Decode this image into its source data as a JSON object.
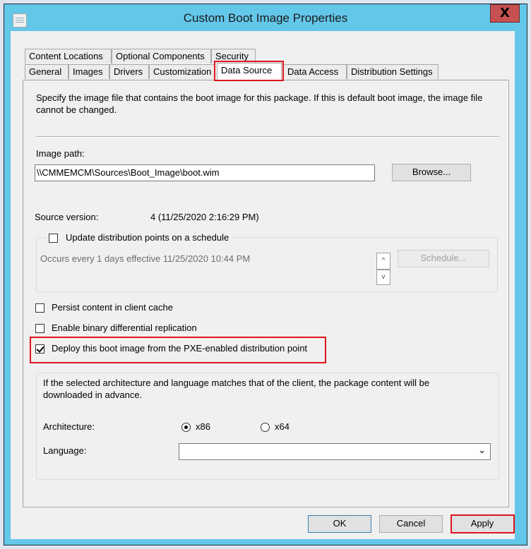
{
  "window": {
    "title": "Custom Boot Image Properties",
    "close_label": "X"
  },
  "tabs": {
    "row1": [
      {
        "label": "Content Locations"
      },
      {
        "label": "Optional Components"
      },
      {
        "label": "Security"
      }
    ],
    "row2": [
      {
        "label": "General"
      },
      {
        "label": "Images"
      },
      {
        "label": "Drivers"
      },
      {
        "label": "Customization"
      },
      {
        "label": "Data Source",
        "active": true
      },
      {
        "label": "Data Access"
      },
      {
        "label": "Distribution Settings"
      }
    ]
  },
  "data_source": {
    "description": "Specify the image file that contains the boot image for this package. If this is default boot image, the image file cannot be changed.",
    "image_path_label": "Image path:",
    "image_path_value": "\\\\CMMEMCM\\Sources\\Boot_Image\\boot.wim",
    "browse_label": "Browse...",
    "source_version_label": "Source version:",
    "source_version_value": "4 (11/25/2020 2:16:29 PM)",
    "schedule_group": {
      "checkbox_label": "Update distribution points on a schedule",
      "checked": false,
      "schedule_text": "Occurs every 1 days effective 11/25/2020 10:44 PM",
      "schedule_button": "Schedule...",
      "spin_up": "^",
      "spin_down": "v"
    },
    "persist_label": "Persist content in client cache",
    "persist_checked": false,
    "binary_label": "Enable binary differential replication",
    "binary_checked": false,
    "pxe_label": "Deploy this boot image from the PXE-enabled distribution point",
    "pxe_checked": true,
    "prestage_group": {
      "description": "If the selected architecture and language matches that of the client, the package content will be downloaded in advance.",
      "architecture_label": "Architecture:",
      "arch_options": [
        {
          "label": "x86",
          "selected": true
        },
        {
          "label": "x64",
          "selected": false
        }
      ],
      "language_label": "Language:",
      "language_value": "",
      "dropdown_arrow": "⌄"
    }
  },
  "footer": {
    "ok_label": "OK",
    "cancel_label": "Cancel",
    "apply_label": "Apply"
  },
  "highlight_color": "#e0141e",
  "titlebar_color": "#63c7ea"
}
